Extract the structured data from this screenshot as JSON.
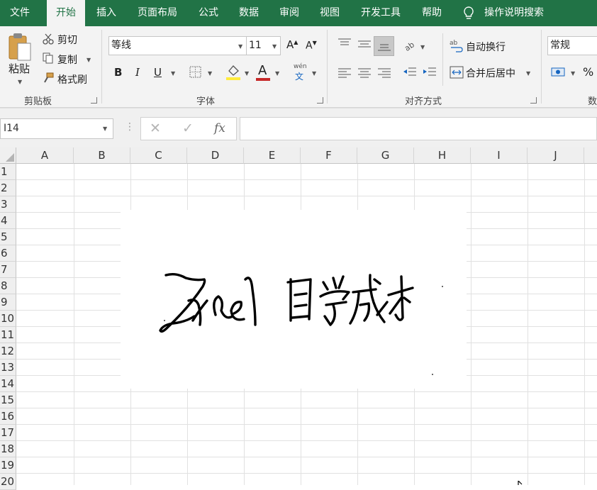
{
  "tabs": [
    {
      "label": "文件"
    },
    {
      "label": "开始",
      "active": true
    },
    {
      "label": "插入"
    },
    {
      "label": "页面布局"
    },
    {
      "label": "公式"
    },
    {
      "label": "数据"
    },
    {
      "label": "审阅"
    },
    {
      "label": "视图"
    },
    {
      "label": "开发工具"
    },
    {
      "label": "帮助"
    }
  ],
  "tell_me": "操作说明搜索",
  "clipboard": {
    "paste": "粘贴",
    "cut": "剪切",
    "copy": "复制",
    "format_painter": "格式刷",
    "group": "剪贴板"
  },
  "font": {
    "name": "等线",
    "size": "11",
    "bold": "B",
    "italic": "I",
    "underline": "U",
    "font_color_glyph": "A",
    "phonetic": "wén",
    "phonetic_char": "文",
    "group": "字体",
    "fill_color": "#ffeb3b",
    "font_color": "#c62828"
  },
  "alignment": {
    "wrap": "自动换行",
    "merge": "合并后居中",
    "group": "对齐方式"
  },
  "number": {
    "format": "常规",
    "percent": "%",
    "group": "数"
  },
  "formula_bar": {
    "name_box": "I14",
    "cancel": "✕",
    "enter": "✓",
    "fx": "fx",
    "value": ""
  },
  "columns": [
    "A",
    "B",
    "C",
    "D",
    "E",
    "F",
    "G",
    "H",
    "I",
    "J"
  ],
  "rows": [
    "1",
    "2",
    "3",
    "4",
    "5",
    "6",
    "7",
    "8",
    "9",
    "10",
    "11",
    "12",
    "13",
    "14",
    "15",
    "16",
    "17",
    "18",
    "19",
    "20"
  ],
  "accent": "#217346"
}
